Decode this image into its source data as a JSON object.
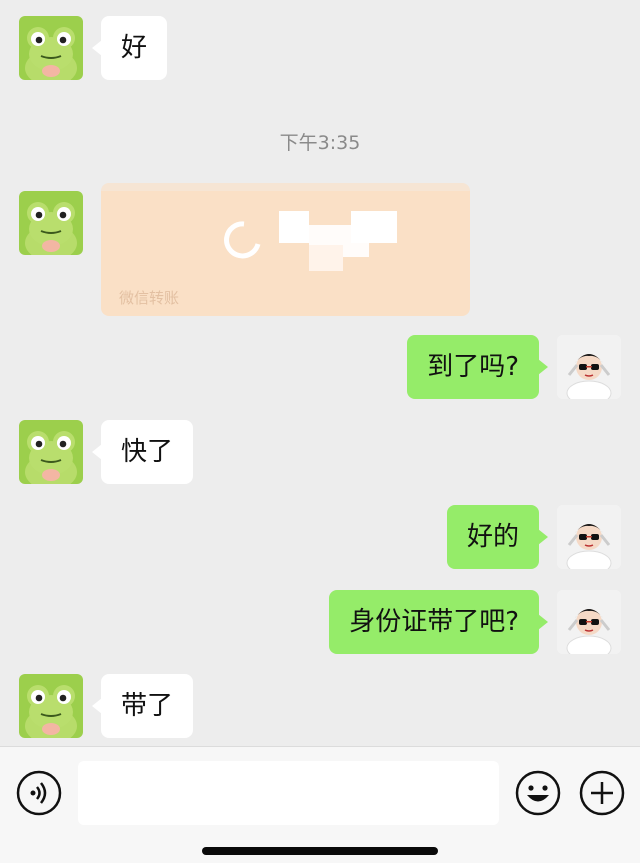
{
  "timestamp": "下午3:35",
  "transfer": {
    "label": "微信转账"
  },
  "messages": [
    {
      "text": "好"
    },
    {
      "text": "到了吗?"
    },
    {
      "text": "快了"
    },
    {
      "text": "好的"
    },
    {
      "text": "身份证带了吧?"
    },
    {
      "text": "带了"
    }
  ],
  "input": {
    "placeholder": ""
  },
  "colors": {
    "background": "#ededed",
    "incoming_bubble": "#ffffff",
    "outgoing_bubble": "#95ec69",
    "transfer_card": "#fae0c6",
    "frog_avatar": "#9ccf4c"
  },
  "icons": [
    "voice-icon",
    "emoji-icon",
    "plus-icon",
    "frog-avatar",
    "contact-photo-avatar"
  ]
}
